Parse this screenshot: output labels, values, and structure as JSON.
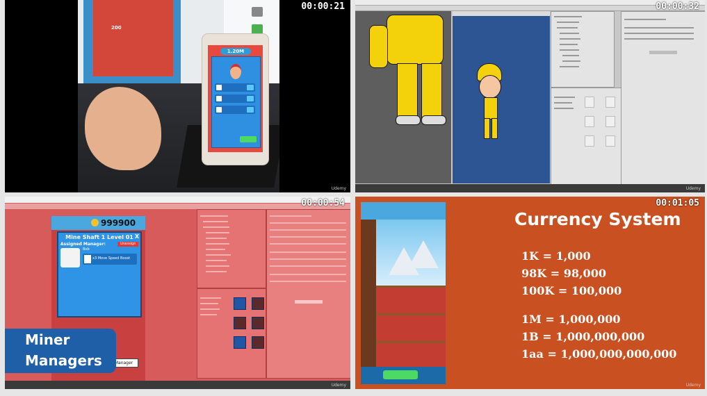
{
  "timestamps": [
    "00:00:21",
    "00:00:32",
    "00:00:54",
    "00:01:05"
  ],
  "watermark": "Udemy",
  "panel1": {
    "phone_coins": "1.20M",
    "mon_coins": "200"
  },
  "panel3": {
    "coins": "999900",
    "dialog_title": "Mine Shaft 1 Level 01",
    "close": "X",
    "assigned_label": "Assigned Manager:",
    "unassign": "Unassign",
    "manager_name": "Bob",
    "boost": "x3 Move Speed Boost",
    "hire_button": "Manager",
    "overlay_line1": "Miner",
    "overlay_line2": "Managers"
  },
  "panel4": {
    "title": "Currency System",
    "rows": [
      "1K = 1,000",
      "98K = 98,000",
      "100K = 100,000",
      "1M = 1,000,000",
      "1B = 1,000,000,000",
      "1aa = 1,000,000,000,000"
    ]
  },
  "colors": {
    "currency_bg": "#c95020",
    "overlay_blue": "#1f5fa8",
    "game_red": "#d94a3c",
    "sky_blue": "#4aa8de",
    "editor_tint": "#d85b5b"
  }
}
